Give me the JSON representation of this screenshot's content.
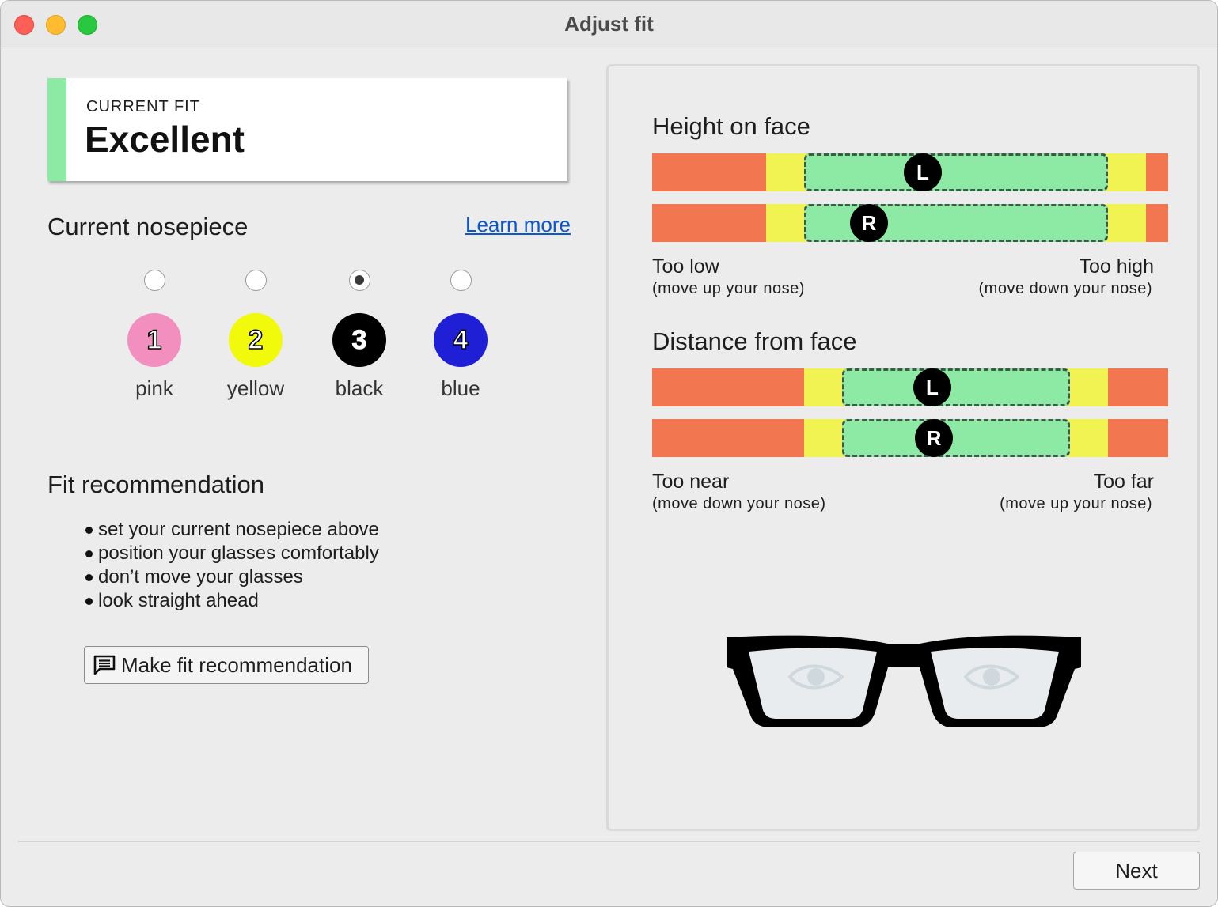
{
  "window": {
    "title": "Adjust fit"
  },
  "current_fit": {
    "label": "CURRENT FIT",
    "value": "Excellent",
    "accent": "#8ceaa4"
  },
  "nosepiece": {
    "title": "Current nosepiece",
    "learn_more": "Learn more",
    "selected": "3",
    "options": [
      {
        "number": "1",
        "name": "pink",
        "color": "#f28fbf",
        "selected": false
      },
      {
        "number": "2",
        "name": "yellow",
        "color": "#f0fa0a",
        "selected": false
      },
      {
        "number": "3",
        "name": "black",
        "color": "#000000",
        "selected": true
      },
      {
        "number": "4",
        "name": "blue",
        "color": "#1f1fd6",
        "selected": false
      }
    ]
  },
  "recommendation": {
    "title": "Fit recommendation",
    "steps": [
      "set your current nosepiece above",
      "position your glasses comfortably",
      "don’t move your glasses",
      "look straight ahead"
    ],
    "button_label": "Make fit recommendation",
    "button_icon": "comment-icon"
  },
  "height": {
    "title": "Height on face",
    "left_marker": "L",
    "right_marker": "R",
    "left_position": 0.524,
    "right_position": 0.42,
    "low_label": "Too low",
    "low_hint": "(move up your nose)",
    "high_label": "Too high",
    "high_hint": "(move down your nose)"
  },
  "distance": {
    "title": "Distance from face",
    "left_marker": "L",
    "right_marker": "R",
    "left_position": 0.543,
    "right_position": 0.547,
    "near_label": "Too near",
    "near_hint": "(move down your nose)",
    "far_label": "Too far",
    "far_hint": "(move up your nose)"
  },
  "colors": {
    "red": "#f27650",
    "yellow": "#f0f352",
    "green": "#8ceaa4"
  },
  "footer": {
    "next_label": "Next"
  }
}
